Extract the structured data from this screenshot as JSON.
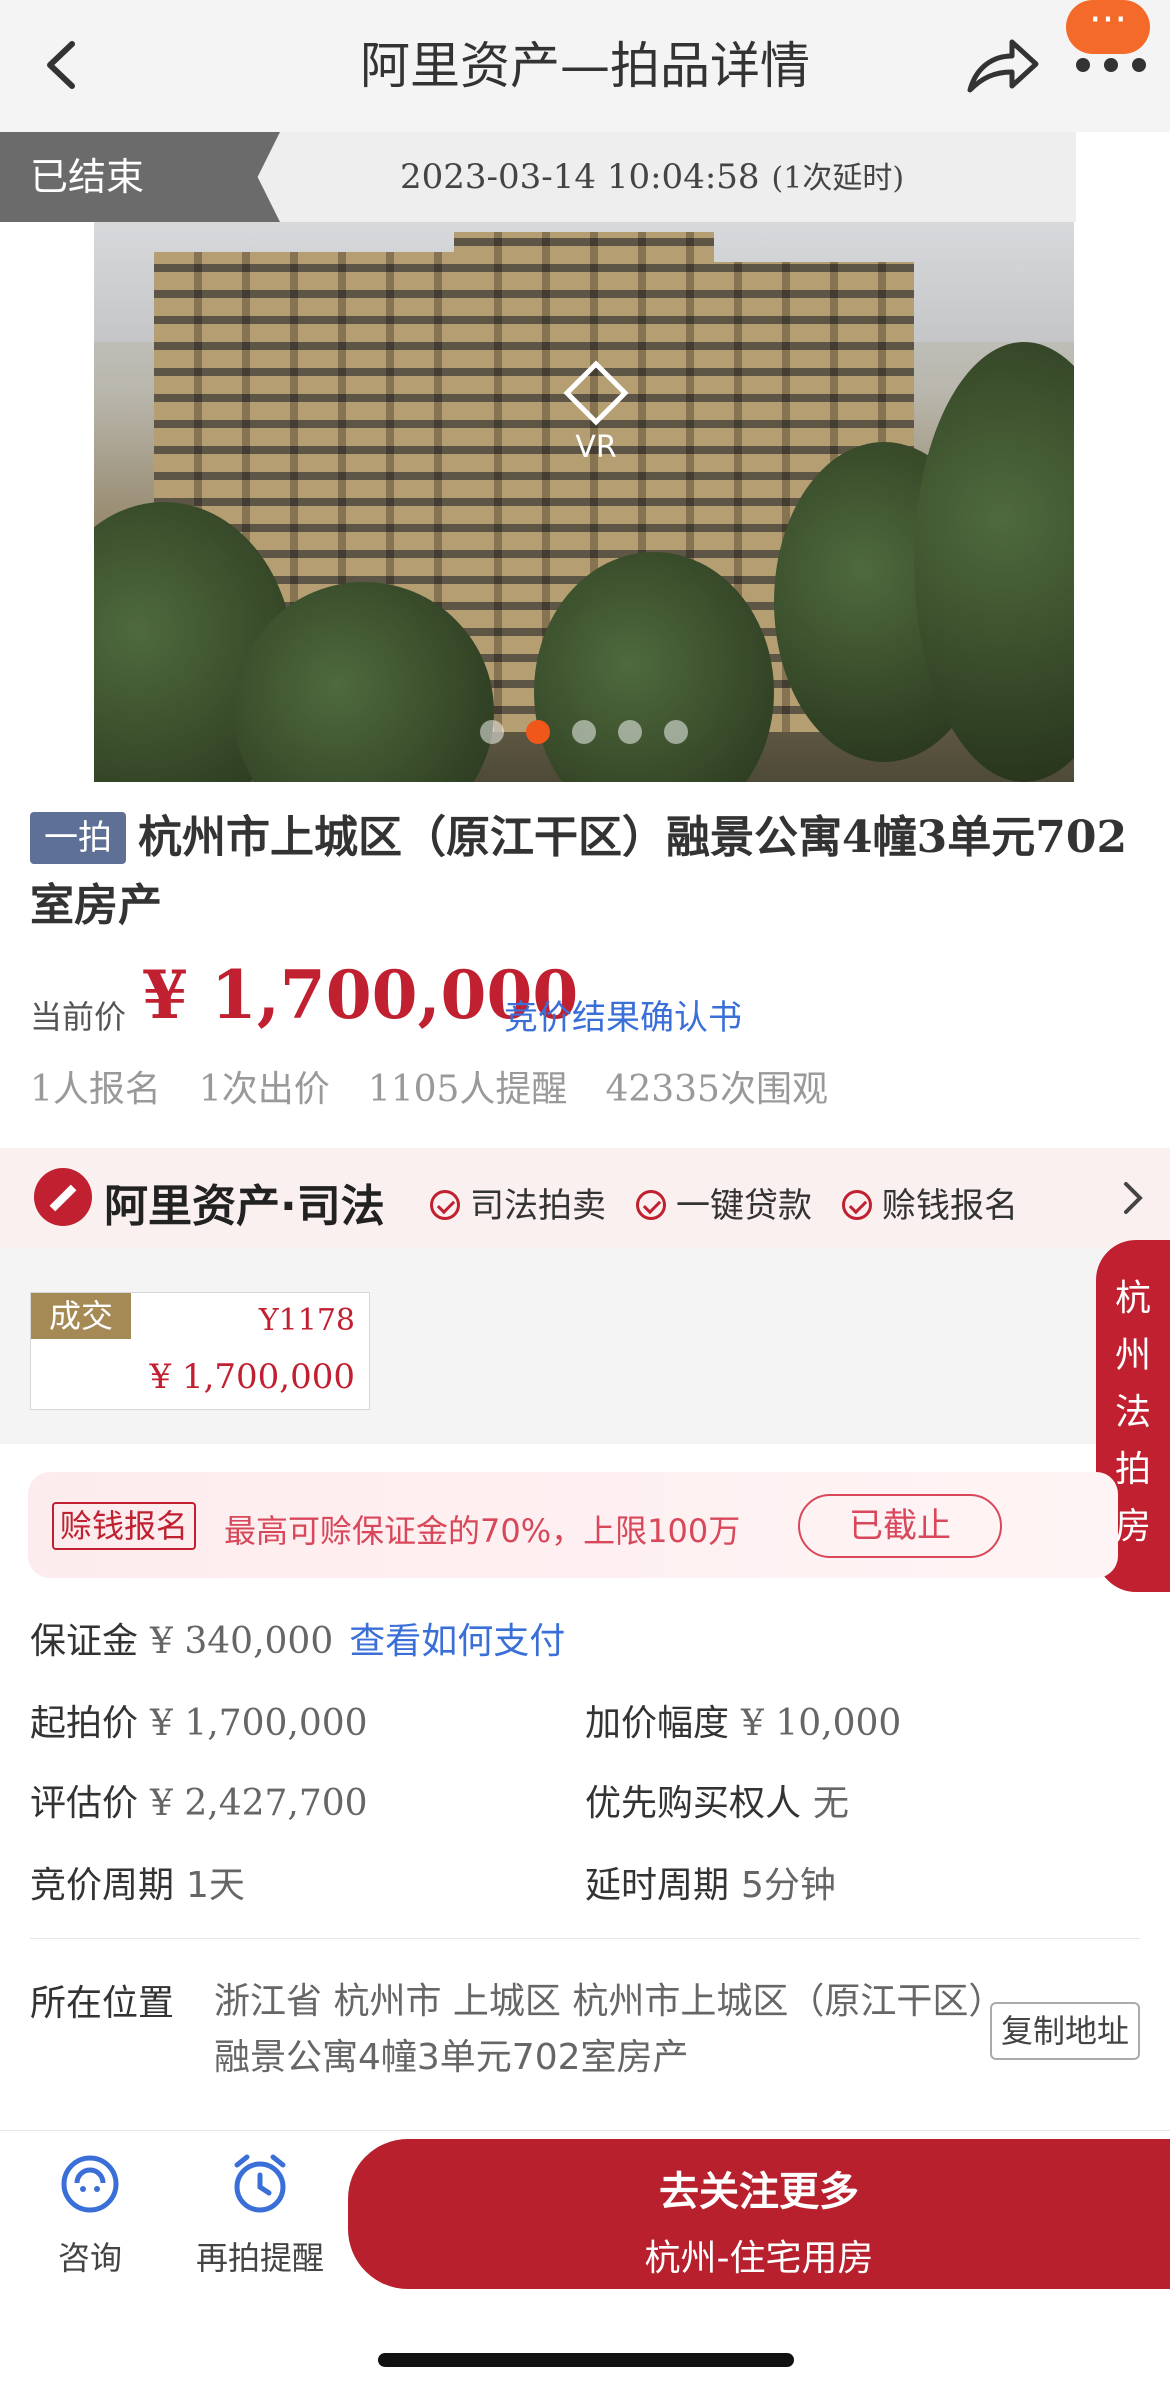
{
  "header": {
    "title": "阿里资产—拍品详情"
  },
  "status": {
    "tag": "已结束",
    "time": "2023-03-14 10:04:58",
    "extension": "(1次延时)"
  },
  "hero": {
    "vr_label": "VR",
    "slides": 5,
    "active_slide": 1
  },
  "lot": {
    "round_tag": "一拍",
    "title": "杭州市上城区（原江干区）融景公寓4幢3单元702室房产",
    "price_label": "当前价",
    "price": "¥ 1,700,000",
    "result_link": "竞价结果确认书",
    "stats": [
      "1人报名",
      "1次出价",
      "1105人提醒",
      "42335次围观"
    ]
  },
  "ali_bar": {
    "brand": "阿里资产·司法",
    "features": [
      "司法拍卖",
      "一键贷款",
      "赊钱报名"
    ]
  },
  "deal": {
    "tag": "成交",
    "code": "Y1178",
    "price": "¥ 1,700,000"
  },
  "side_tab": {
    "chars": [
      "杭",
      "州",
      "法",
      "拍",
      "房"
    ]
  },
  "promo": {
    "tag": "赊钱报名",
    "text": "最高可赊保证金的70%，上限100万",
    "status": "已截止"
  },
  "details": {
    "deposit_label": "保证金",
    "deposit_value": "¥ 340,000",
    "deposit_link": "查看如何支付",
    "start_label": "起拍价",
    "start_value": "¥ 1,700,000",
    "increment_label": "加价幅度",
    "increment_value": "¥ 10,000",
    "appraisal_label": "评估价",
    "appraisal_value": "¥ 2,427,700",
    "priority_label": "优先购买权人",
    "priority_value": "无",
    "period_label": "竞价周期",
    "period_value": "1天",
    "delay_label": "延时周期",
    "delay_value": "5分钟",
    "location_label": "所在位置",
    "location_value": "浙江省 杭州市 上城区 杭州市上城区（原江干区）融景公寓4幢3单元702室房产",
    "copy_label": "复制地址"
  },
  "bottom": {
    "consult": "咨询",
    "remind": "再拍提醒",
    "cta_main": "去关注更多",
    "cta_sub": "杭州-住宅用房"
  },
  "colors": {
    "accent": "#c0202f",
    "link": "#3a6fd8",
    "active_dot": "#f0581b"
  }
}
